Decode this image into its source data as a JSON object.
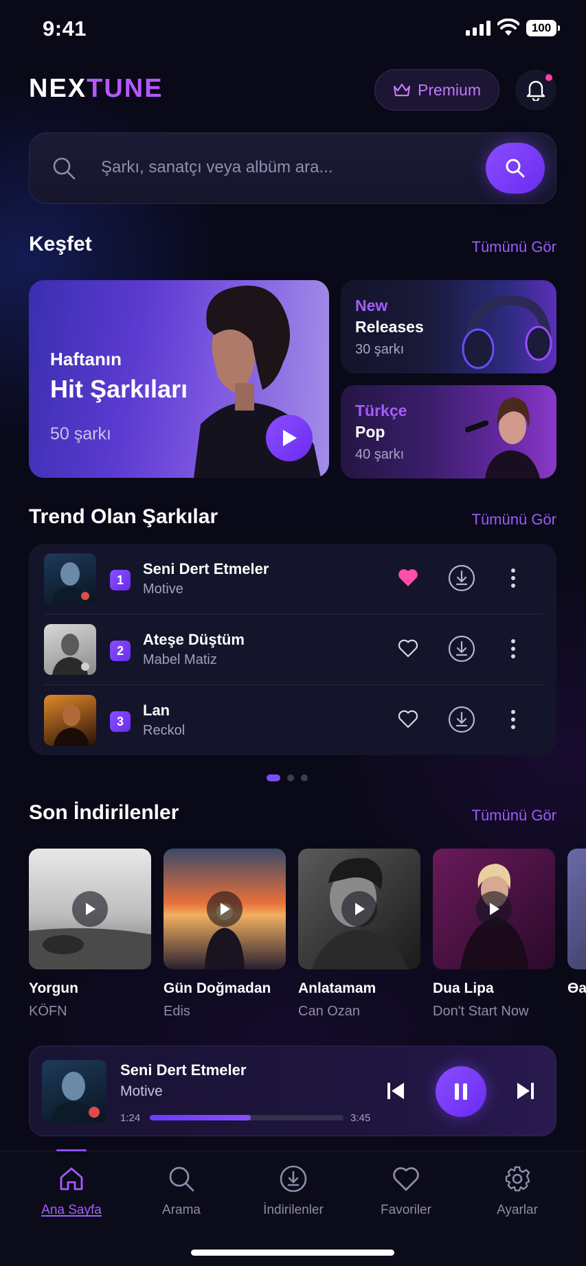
{
  "status_bar": {
    "time": "9:41",
    "battery": "100"
  },
  "header": {
    "logo_part1": "NEX",
    "logo_part2": "TUNE",
    "premium_label": "Premium"
  },
  "search": {
    "placeholder": "Şarkı, sanatçı veya albüm ara..."
  },
  "discover": {
    "title": "Keşfet",
    "see_all": "Tümünü Gör",
    "featured": {
      "subtitle": "Haftanın",
      "title": "Hit Şarkıları",
      "count": "50 şarkı"
    },
    "cards": [
      {
        "accent": "New",
        "title": "Releases",
        "count": "30 şarkı"
      },
      {
        "accent": "Türkçe",
        "title": "Pop",
        "count": "40 şarkı"
      }
    ]
  },
  "trending": {
    "title": "Trend Olan Şarkılar",
    "see_all": "Tümünü Gör",
    "songs": [
      {
        "rank": "1",
        "title": "Seni Dert Etmeler",
        "artist": "Motive",
        "liked": true
      },
      {
        "rank": "2",
        "title": "Ateşe Düştüm",
        "artist": "Mabel Matiz",
        "liked": false
      },
      {
        "rank": "3",
        "title": "Lan",
        "artist": "Reckol",
        "liked": false
      }
    ],
    "page_count": 3,
    "active_page": 1
  },
  "downloads": {
    "title": "Son İndirilenler",
    "see_all": "Tümünü Gör",
    "items": [
      {
        "title": "Yorgun",
        "subtitle": "KÖFN"
      },
      {
        "title": "Gün Doğmadan",
        "subtitle": "Edis"
      },
      {
        "title": "Anlatamam",
        "subtitle": "Can Ozan"
      },
      {
        "title": "Dua Lipa",
        "subtitle": "Don't Start Now"
      },
      {
        "title": "Өa",
        "subtitle": ""
      }
    ]
  },
  "player": {
    "title": "Seni Dert Etmeler",
    "artist": "Motive",
    "current": "1:24",
    "total": "3:45",
    "progress": 0.52
  },
  "tabs": [
    {
      "label": "Ana Sayfa",
      "icon": "home-icon",
      "active": true
    },
    {
      "label": "Arama",
      "icon": "search-icon",
      "active": false
    },
    {
      "label": "İndirilenler",
      "icon": "download-icon",
      "active": false
    },
    {
      "label": "Favoriler",
      "icon": "heart-icon",
      "active": false
    },
    {
      "label": "Ayarlar",
      "icon": "gear-icon",
      "active": false
    }
  ],
  "colors": {
    "accent": "#8a4dff",
    "accent_text": "#a45cff",
    "like": "#ff4fa8",
    "background": "#090917"
  }
}
